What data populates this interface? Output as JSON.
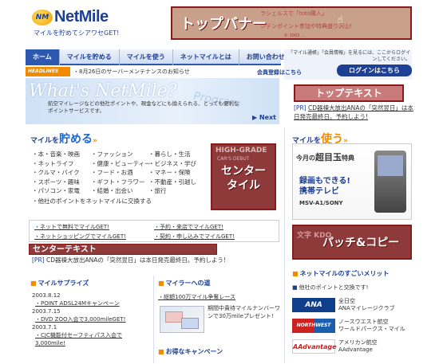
{
  "header": {
    "logo_mark": "NM",
    "logo_name": "NetMile",
    "tagline": "マイルを貯めてシアワセGET!",
    "top_banner": {
      "label": "トップバナー",
      "ghost_line1": "ラシェルスで「toto購入」",
      "ghost_line2": "ジテンポイント参加や特典盛り沢山!",
      "copy": "© 2003 ..."
    }
  },
  "nav": {
    "tabs": [
      "ホーム",
      "マイルを貯める",
      "マイルを使う",
      "ネットマイルとは",
      "お問い合わせ"
    ]
  },
  "login": {
    "text": "「マイル通帳」「会員情報」を見るには、ここからログインしてください。",
    "button": "ログインはこちら",
    "register": "会員登録はこちら"
  },
  "headlines": {
    "badge": "HEADLINES",
    "text": "・8月26日のサーバーメンテナンスのお知らせ"
  },
  "hero": {
    "title": "What's NetMile?",
    "text": "航空マイレージなどの他社ポイントや、現金などにも換えられる、とっても便利なポイントサービスです。",
    "watermark": "Program",
    "next": "Next"
  },
  "right_top": {
    "banner": "トップテキスト",
    "pr_tag": "[PR]",
    "pr_text": "CD器棟大放出ANAの「突然翌日」は本日発売最終日。予約しよう!"
  },
  "earn": {
    "head_prefix": "マイルを",
    "head_big": "貯める",
    "col1": [
      "本・音楽・映画",
      "ネットライフ",
      "クルマ・バイク",
      "スポーツ・趣味",
      "パソコン・家電"
    ],
    "col2": [
      "ファッション",
      "健康・ビューティー",
      "フード・お酒",
      "ギフト・フラワー",
      "結婚・出会い"
    ],
    "col3": [
      "暮らし・生活",
      "ビジネス・学び",
      "マネー・保険",
      "不動産・引越し",
      "旅行"
    ],
    "other": "他社のポイントをネットマイルに交換する",
    "links": [
      "ネットで無料でマイルGET!",
      "予約・来店でマイルGET!",
      "ネットショッピングでマイルGET!",
      "契約・申し込みでマイルGET!"
    ]
  },
  "center_tile": {
    "bg1": "HIGH-GRADE",
    "bg2": "CAR'S DEBUT",
    "label_line1": "センター",
    "label_line2": "タイル"
  },
  "center_text": {
    "banner": "センターテキスト",
    "pr_tag": "[PR]",
    "pr_text": "CD器棟大放出ANAの「突然翌日」は本日発売最終日。予約しよう!"
  },
  "surprises": {
    "head": "マイルサプライズ",
    "items": [
      {
        "date": "2003.8.12",
        "text": "POINT ADSL24Mキャンペーン"
      },
      {
        "date": "2003.7.15",
        "text": "DVD ZOO入会で3,000mileGET!"
      },
      {
        "date": "2003.7.1",
        "text": "CJC機能付セーフティパス入会で3,000mile!"
      }
    ]
  },
  "road": {
    "head": "マイラーへの道",
    "link": "総額100万マイル争奪レース",
    "text": "期間中貴待マイルナンバーワンで30万mileプレゼント!"
  },
  "campaign": {
    "head": "お得なキャンペーン"
  },
  "use": {
    "head_prefix": "マイルを",
    "head_big": "使う",
    "t1_prefix": "今月の",
    "t1_big": "超目玉",
    "t1_suffix": "特典",
    "t2_line1": "録画もできる!",
    "t2_line2": "携帯テレビ",
    "t3": "MSV-A1/SONY"
  },
  "patch": {
    "bg": "文字 KDO",
    "label": "パッチ&コピー"
  },
  "merit": {
    "head": "ネットマイルのすごいメリット",
    "sub": "他社のポイントと交換です!",
    "airlines": [
      {
        "logo": "ANA",
        "line1": "全日空",
        "line2": "ANAマイレージクラブ"
      },
      {
        "logo": "NORTHWEST KLM",
        "line1": "ノースウエスト航空",
        "line2": "ワールドパークス・マイル"
      },
      {
        "logo": "AAdvantage",
        "line1": "アメリカン航空",
        "line2": "AAdvantage"
      }
    ]
  }
}
